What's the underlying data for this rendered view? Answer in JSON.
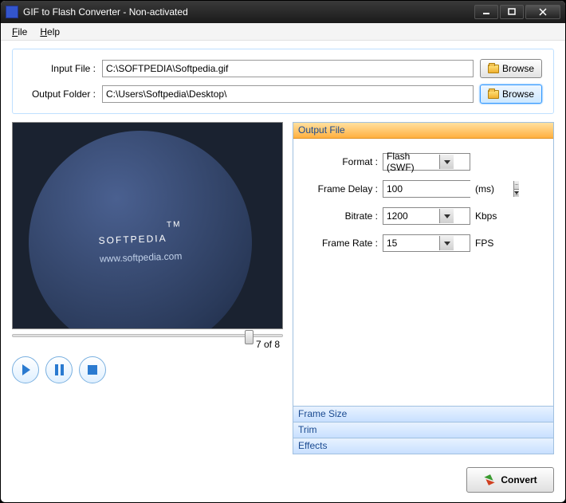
{
  "window": {
    "title": "GIF to Flash Converter - Non-activated"
  },
  "menu": {
    "file": "File",
    "help": "Help"
  },
  "files": {
    "input_label": "Input File :",
    "input_value": "C:\\SOFTPEDIA\\Softpedia.gif",
    "output_label": "Output Folder :",
    "output_value": "C:\\Users\\Softpedia\\Desktop\\",
    "browse": "Browse"
  },
  "preview": {
    "brand": "SOFTPEDIA",
    "tm": "TM",
    "url": "www.softpedia.com",
    "counter": "7 of 8"
  },
  "sections": {
    "output_file": "Output File",
    "frame_size": "Frame Size",
    "trim": "Trim",
    "effects": "Effects"
  },
  "settings": {
    "format_label": "Format :",
    "format_value": "Flash (SWF)",
    "frame_delay_label": "Frame Delay :",
    "frame_delay_value": "100",
    "frame_delay_unit": "(ms)",
    "bitrate_label": "Bitrate :",
    "bitrate_value": "1200",
    "bitrate_unit": "Kbps",
    "frame_rate_label": "Frame Rate :",
    "frame_rate_value": "15",
    "frame_rate_unit": "FPS"
  },
  "actions": {
    "convert": "Convert"
  }
}
